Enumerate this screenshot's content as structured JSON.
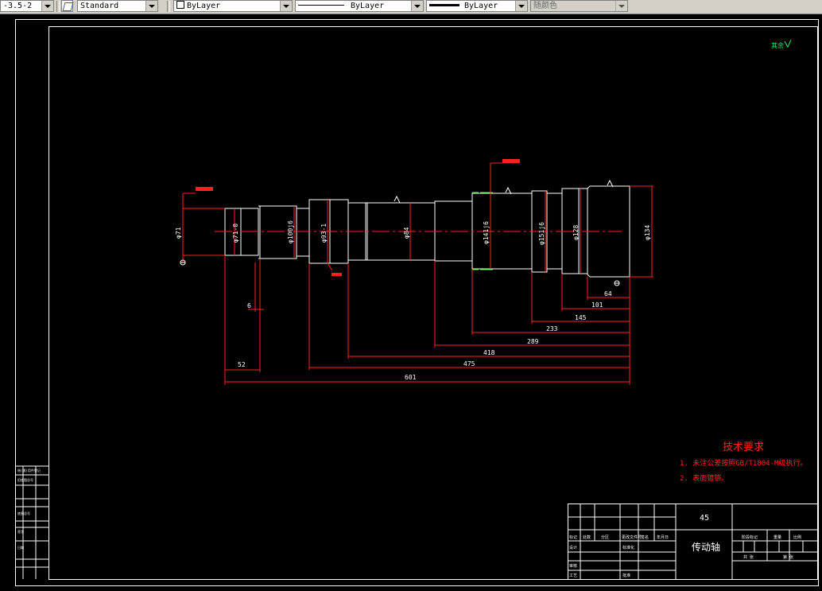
{
  "toolbar": {
    "dimstyle": "-3.5-2",
    "textstyle": "Standard",
    "layer": "ByLayer",
    "linetype": "ByLayer",
    "lineweight": "ByLayer",
    "color": "随颜色"
  },
  "drawing": {
    "roughness_note": "其余",
    "material": "45",
    "part_name": "传动轴",
    "tech_title": "技术要求",
    "tech_items": [
      "1. 未注公差按照GB/T1804-M级执行。",
      "2. 表面镀铬。"
    ],
    "diameters": {
      "d71": "φ71",
      "d71m": "φ71-0",
      "d100": "φ100j6",
      "d93": "φ93-1",
      "d84": "φ84",
      "d141": "φ141j6",
      "d151": "φ151j6",
      "d128": "φ128",
      "d134": "φ134"
    },
    "dims": {
      "d64": "64",
      "d101": "101",
      "d145": "145",
      "d233": "233",
      "d289": "289",
      "d418": "418",
      "d475": "475",
      "d601": "601",
      "d52": "52",
      "d6": "6"
    },
    "title_block": {
      "sheets": "共  张",
      "sheet_no": "第  张",
      "ratio_label": "重量",
      "scale_label": "比例",
      "stage_label": "阶段标记",
      "mark": "标记",
      "count": "处数",
      "zone": "分区",
      "change_no": "更改文件号",
      "sign": "签名",
      "date": "年月日",
      "design": "设计",
      "std": "标准化",
      "review": "审核",
      "process": "工艺",
      "approve": "批准"
    },
    "side_table": [
      "借(通)用件登记",
      "旧底图总号",
      "底图总号",
      "签字",
      "日期"
    ]
  }
}
